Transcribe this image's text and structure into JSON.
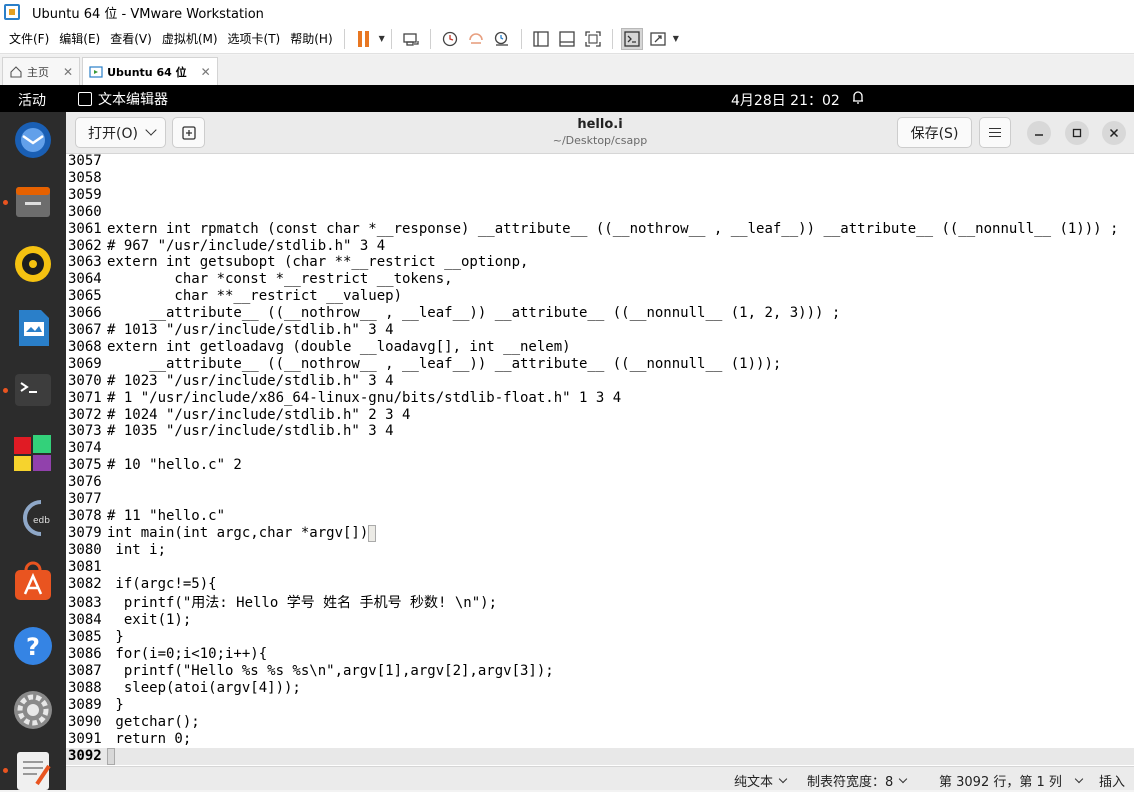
{
  "vmware": {
    "title": "Ubuntu 64 位 - VMware Workstation",
    "menu": [
      "文件(F)",
      "编辑(E)",
      "查看(V)",
      "虚拟机(M)",
      "选项卡(T)",
      "帮助(H)"
    ],
    "tabs": [
      {
        "label": "主页",
        "icon": "home-icon"
      },
      {
        "label": "Ubuntu 64 位",
        "icon": "vm-icon"
      }
    ]
  },
  "ubuntu": {
    "activities": "活动",
    "app_name": "文本编辑器",
    "clock": "4月28日  21：02"
  },
  "gedit": {
    "open_label": "打开(O)",
    "title": "hello.i",
    "path": "~/Desktop/csapp",
    "save_label": "保存(S)",
    "lines": [
      {
        "n": "3057",
        "t": ""
      },
      {
        "n": "3058",
        "t": ""
      },
      {
        "n": "3059",
        "t": ""
      },
      {
        "n": "3060",
        "t": ""
      },
      {
        "n": "3061",
        "t": "extern int rpmatch (const char *__response) __attribute__ ((__nothrow__ , __leaf__)) __attribute__ ((__nonnull__ (1))) ;"
      },
      {
        "n": "3062",
        "t": "# 967 \"/usr/include/stdlib.h\" 3 4"
      },
      {
        "n": "3063",
        "t": "extern int getsubopt (char **__restrict __optionp,"
      },
      {
        "n": "3064",
        "t": "        char *const *__restrict __tokens,"
      },
      {
        "n": "3065",
        "t": "        char **__restrict __valuep)"
      },
      {
        "n": "3066",
        "t": "     __attribute__ ((__nothrow__ , __leaf__)) __attribute__ ((__nonnull__ (1, 2, 3))) ;"
      },
      {
        "n": "3067",
        "t": "# 1013 \"/usr/include/stdlib.h\" 3 4"
      },
      {
        "n": "3068",
        "t": "extern int getloadavg (double __loadavg[], int __nelem)"
      },
      {
        "n": "3069",
        "t": "     __attribute__ ((__nothrow__ , __leaf__)) __attribute__ ((__nonnull__ (1)));"
      },
      {
        "n": "3070",
        "t": "# 1023 \"/usr/include/stdlib.h\" 3 4"
      },
      {
        "n": "3071",
        "t": "# 1 \"/usr/include/x86_64-linux-gnu/bits/stdlib-float.h\" 1 3 4"
      },
      {
        "n": "3072",
        "t": "# 1024 \"/usr/include/stdlib.h\" 2 3 4"
      },
      {
        "n": "3073",
        "t": "# 1035 \"/usr/include/stdlib.h\" 3 4"
      },
      {
        "n": "3074",
        "t": ""
      },
      {
        "n": "3075",
        "t": "# 10 \"hello.c\" 2"
      },
      {
        "n": "3076",
        "t": ""
      },
      {
        "n": "3077",
        "t": ""
      },
      {
        "n": "3078",
        "t": "# 11 \"hello.c\""
      },
      {
        "n": "3079",
        "t": "int main(int argc,char *argv[])"
      },
      {
        "n": "3080",
        "t": " int i;"
      },
      {
        "n": "3081",
        "t": ""
      },
      {
        "n": "3082",
        "t": " if(argc!=5){"
      },
      {
        "n": "3083",
        "t": "  printf(\"用法: Hello 学号 姓名 手机号 秒数! \\n\");"
      },
      {
        "n": "3084",
        "t": "  exit(1);"
      },
      {
        "n": "3085",
        "t": " }"
      },
      {
        "n": "3086",
        "t": " for(i=0;i<10;i++){"
      },
      {
        "n": "3087",
        "t": "  printf(\"Hello %s %s %s\\n\",argv[1],argv[2],argv[3]);"
      },
      {
        "n": "3088",
        "t": "  sleep(atoi(argv[4]));"
      },
      {
        "n": "3089",
        "t": " }"
      },
      {
        "n": "3090",
        "t": " getchar();"
      },
      {
        "n": "3091",
        "t": " return 0;"
      },
      {
        "n": "3092",
        "t": ""
      }
    ],
    "status": {
      "lang": "纯文本",
      "tab_width": "制表符宽度：8",
      "position": "第 3092 行，第 1 列",
      "mode": "插入"
    }
  },
  "colors": {
    "ubuntu_orange": "#e95420",
    "dock_bg": "#2c2c2c",
    "vmware_pause": "#e87722"
  }
}
